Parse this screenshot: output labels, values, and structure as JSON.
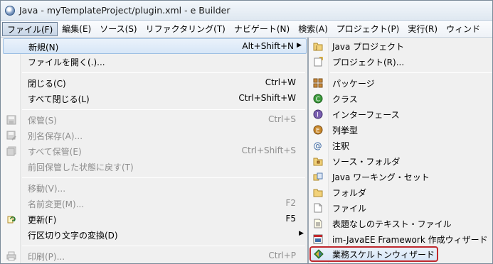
{
  "window": {
    "title": "Java - myTemplateProject/plugin.xml - e Builder"
  },
  "menubar": [
    {
      "label": "ファイル(F)"
    },
    {
      "label": "編集(E)"
    },
    {
      "label": "ソース(S)"
    },
    {
      "label": "リファクタリング(T)"
    },
    {
      "label": "ナビゲート(N)"
    },
    {
      "label": "検索(A)"
    },
    {
      "label": "プロジェクト(P)"
    },
    {
      "label": "実行(R)"
    },
    {
      "label": "ウィンド"
    }
  ],
  "file_menu": {
    "new": {
      "label": "新規(N)",
      "shortcut": "Alt+Shift+N"
    },
    "open_file": {
      "label": "ファイルを開く(.)..."
    },
    "close": {
      "label": "閉じる(C)",
      "shortcut": "Ctrl+W"
    },
    "close_all": {
      "label": "すべて閉じる(L)",
      "shortcut": "Ctrl+Shift+W"
    },
    "save": {
      "label": "保管(S)",
      "shortcut": "Ctrl+S"
    },
    "save_as": {
      "label": "別名保存(A)..."
    },
    "save_all": {
      "label": "すべて保管(E)",
      "shortcut": "Ctrl+Shift+S"
    },
    "revert": {
      "label": "前回保管した状態に戻す(T)"
    },
    "move": {
      "label": "移動(V)..."
    },
    "rename": {
      "label": "名前変更(M)...",
      "shortcut": "F2"
    },
    "refresh": {
      "label": "更新(F)",
      "shortcut": "F5"
    },
    "convert_line_delimiters": {
      "label": "行区切り文字の変換(D)"
    },
    "print": {
      "label": "印刷(P)...",
      "shortcut": "Ctrl+P"
    }
  },
  "new_submenu": [
    {
      "label": "Java プロジェクト",
      "icon": "java-project-icon"
    },
    {
      "label": "プロジェクト(R)...",
      "icon": "project-icon"
    },
    {
      "label": "パッケージ",
      "icon": "package-icon"
    },
    {
      "label": "クラス",
      "icon": "class-icon"
    },
    {
      "label": "インターフェース",
      "icon": "interface-icon"
    },
    {
      "label": "列挙型",
      "icon": "enum-icon"
    },
    {
      "label": "注釈",
      "icon": "annotation-icon"
    },
    {
      "label": "ソース・フォルダ",
      "icon": "source-folder-icon"
    },
    {
      "label": "Java ワーキング・セット",
      "icon": "working-set-icon"
    },
    {
      "label": "フォルダ",
      "icon": "folder-icon"
    },
    {
      "label": "ファイル",
      "icon": "file-icon"
    },
    {
      "label": "表題なしのテキスト・ファイル",
      "icon": "untitled-text-file-icon"
    },
    {
      "label": "im-JavaEE Framework 作成ウィザード",
      "icon": "framework-wizard-icon"
    },
    {
      "label": "業務スケルトンウィザード",
      "icon": "skeleton-wizard-icon"
    }
  ],
  "colors": {
    "highlight_border": "#c0282d",
    "menu_background": "#f0f0f0"
  }
}
